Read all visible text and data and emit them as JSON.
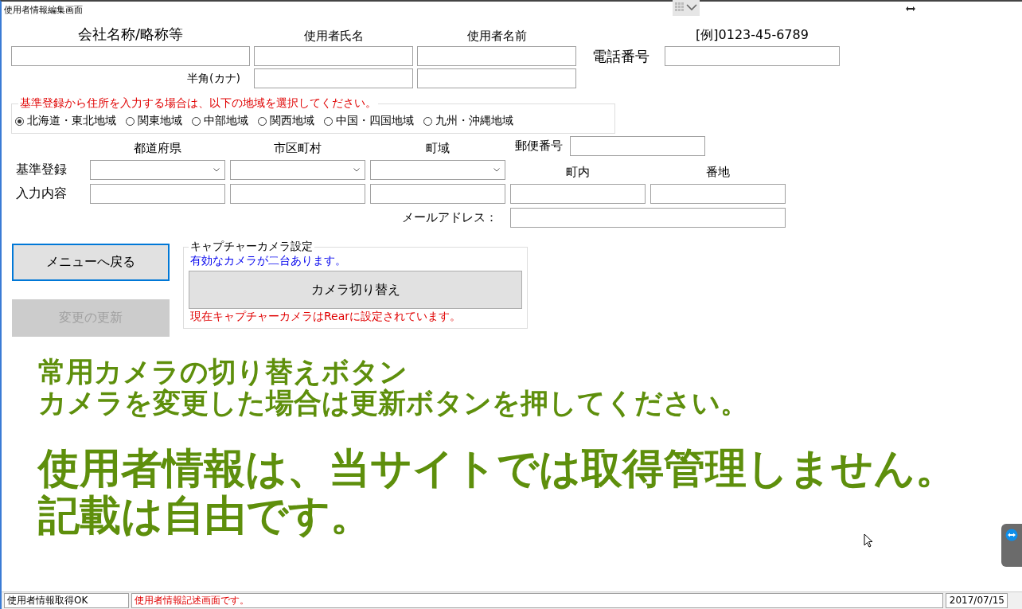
{
  "window": {
    "title": "使用者情報編集画面"
  },
  "user": {
    "company_label": "会社名称/略称等",
    "surname_label": "使用者氏名",
    "given_label": "使用者名前",
    "kana_label": "半角(カナ)",
    "phone_label": "電話番号",
    "phone_example": "[例]0123-45-6789"
  },
  "region": {
    "legend": "基準登録から住所を入力する場合は、以下の地域を選択してください。",
    "options": [
      {
        "label": "北海道・東北地域",
        "selected": true
      },
      {
        "label": "関東地域",
        "selected": false
      },
      {
        "label": "中部地域",
        "selected": false
      },
      {
        "label": "関西地域",
        "selected": false
      },
      {
        "label": "中国・四国地域",
        "selected": false
      },
      {
        "label": "九州・沖縄地域",
        "selected": false
      }
    ]
  },
  "address": {
    "row_labels": [
      "基準登録",
      "入力内容"
    ],
    "columns": [
      "都道府県",
      "市区町村",
      "町域"
    ],
    "postal_label": "郵便番号",
    "town_label": "町内",
    "lot_label": "番地",
    "email_label": "メールアドレス："
  },
  "buttons": [
    {
      "label": "メニューへ戻る",
      "focused": true,
      "disabled": false
    },
    {
      "label": "変更の更新",
      "focused": false,
      "disabled": true
    }
  ],
  "camera": {
    "legend": "キャプチャーカメラ設定",
    "info": "有効なカメラが二台あります。",
    "switch_button": "カメラ切り替え",
    "status": "現在キャプチャーカメラはRearに設定されています。"
  },
  "notes": [
    {
      "text": "常用カメラの切り替えボタン",
      "kind": "small"
    },
    {
      "text": "カメラを変更した場合は更新ボタンを押してください。",
      "kind": "small"
    },
    {
      "text": "使用者情報は、当サイトでは取得管理しません。",
      "kind": "large"
    },
    {
      "text": "記載は自由です。",
      "kind": "large"
    }
  ],
  "status_bar": [
    {
      "text": "使用者情報取得OK",
      "kind": "normal"
    },
    {
      "text": "使用者情報記述画面です。",
      "kind": "message"
    },
    {
      "text": "2017/07/15",
      "kind": "date"
    }
  ]
}
